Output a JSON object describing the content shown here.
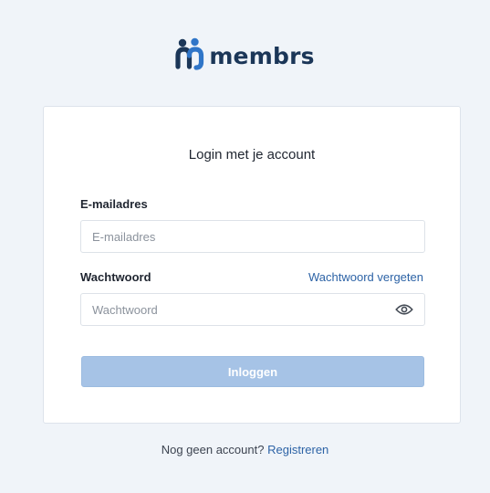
{
  "brand": {
    "logo_icon": "membrs-people-logo",
    "name": "membrs",
    "colors": {
      "dark": "#1b3658",
      "accent": "#2f75c8"
    }
  },
  "login_card": {
    "title": "Login met je account",
    "email": {
      "label": "E-mailadres",
      "placeholder": "E-mailadres",
      "value": ""
    },
    "password": {
      "label": "Wachtwoord",
      "placeholder": "Wachtwoord",
      "value": "",
      "forgot_label": "Wachtwoord vergeten",
      "visibility_icon": "eye-icon"
    },
    "submit_label": "Inloggen",
    "submit_color": "#a6c3e6"
  },
  "footer": {
    "prompt": "Nog geen account?",
    "register_label": "Registreren"
  },
  "link_color": "#2d63a6",
  "background_color": "#f0f4f9"
}
